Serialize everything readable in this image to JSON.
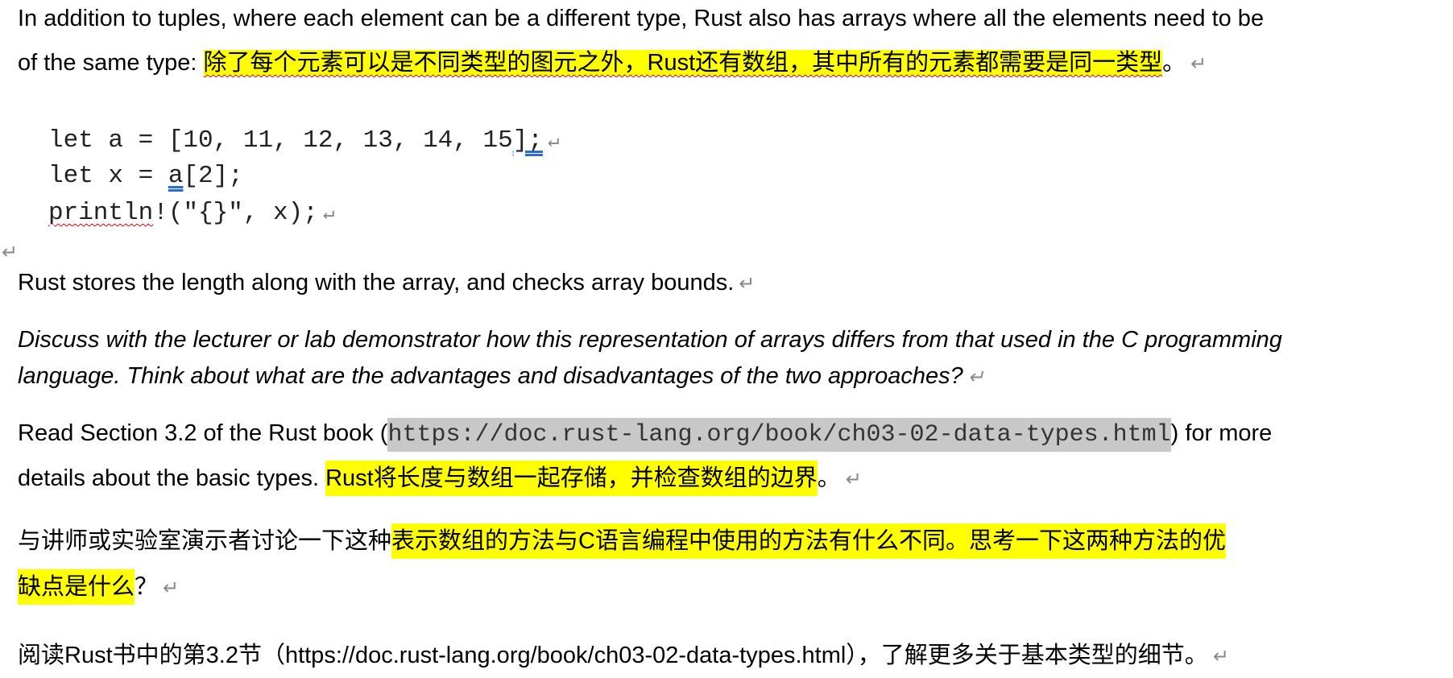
{
  "document": {
    "p1": {
      "line1": "In addition to tuples, where each element can be a different type, Rust also has arrays where all the elements need to be",
      "line2_en": "of the same type: ",
      "line2_zh": "除了每个元素可以是不同类型的图元之外，Rust还有数组，其中所有的元素都需要是同一类型",
      "line2_end": "。"
    },
    "code": {
      "line1_a": "let a = [10, 11, 12, 13, 14, 15",
      "line1_b": "];",
      "line2_a": "let x = ",
      "line2_b": "a",
      "line2_c": "[2];",
      "line3_a": "println",
      "line3_b": "!(\"{}\", x);"
    },
    "p2": "Rust stores the length along with the array, and checks array bounds.",
    "p3": {
      "line1": "Discuss with the lecturer or lab demonstrator how this representation of arrays differs from that used in the C programming",
      "line2": "language. Think about what are the advantages and disadvantages of the two approaches?"
    },
    "p4": {
      "pre": "Read Section 3.2 of the Rust book (",
      "url": "https://doc.rust-lang.org/book/ch03-02-data-types.html",
      "post": ") for more",
      "line2_en": "details about the basic types. ",
      "line2_zh": "Rust将长度与数组一起存储，并检查数组的边界",
      "line2_end": "。"
    },
    "p5": {
      "pre": "与讲师或实验室演示者讨论一下这种",
      "hl1": "表示数组的方法与C语言编程中使用的方法有什么不同。思考一下这两种方法的优",
      "hl2": "缺点是什么",
      "end": "？"
    },
    "p6": "阅读Rust书中的第3.2节（https://doc.rust-lang.org/book/ch03-02-data-types.html），了解更多关于基本类型的细节。",
    "paragraph_mark": "↵"
  },
  "colors": {
    "highlight": "#ffff00",
    "url_shading": "#c8c8c8"
  }
}
